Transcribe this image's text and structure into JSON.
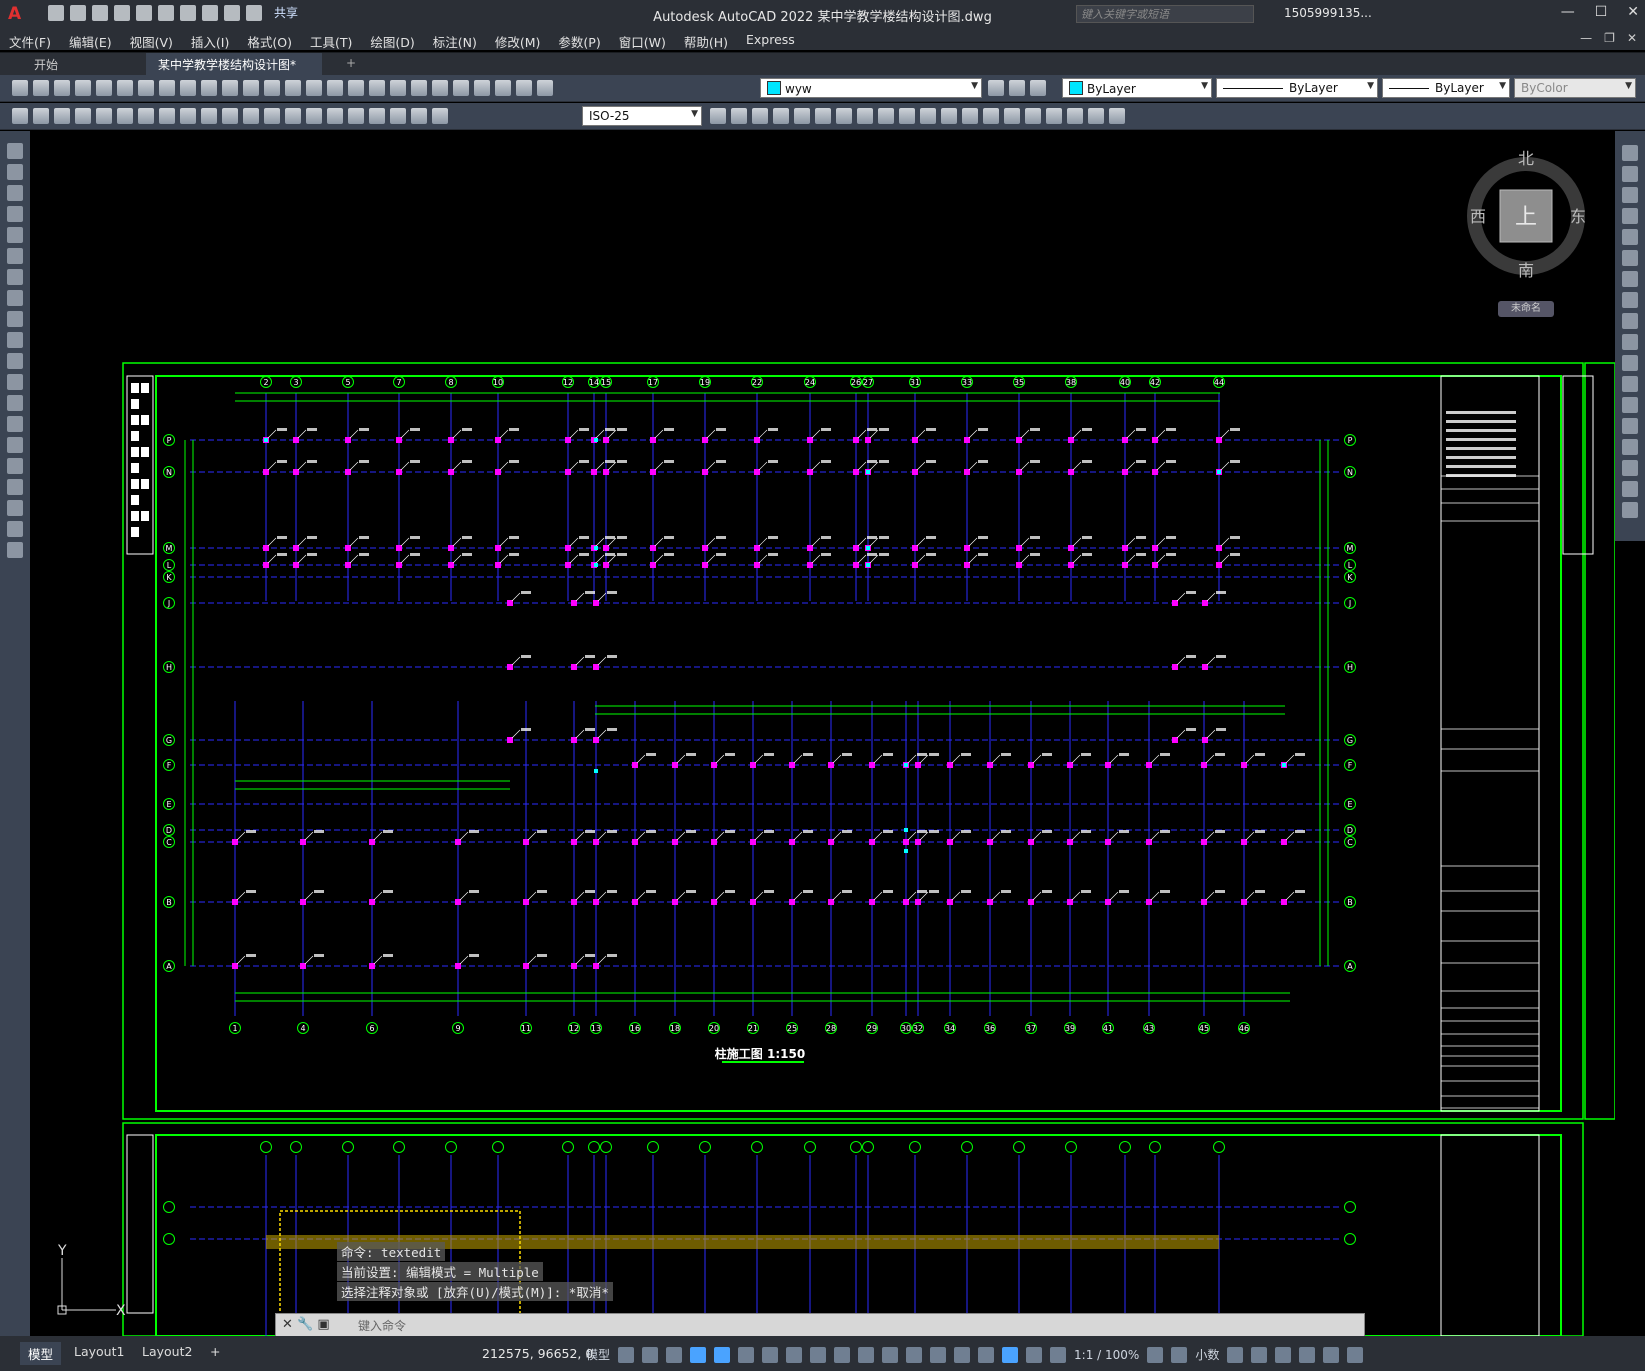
{
  "app": {
    "logo": "A",
    "title": "Autodesk AutoCAD 2022    某中学教学楼结构设计图.dwg",
    "share_label": "共享",
    "search_placeholder": "键入关键字或短语",
    "user": "1505999135...",
    "window_controls": [
      "—",
      "☐",
      "✕"
    ]
  },
  "menu": {
    "items": [
      "文件(F)",
      "编辑(E)",
      "视图(V)",
      "插入(I)",
      "格式(O)",
      "工具(T)",
      "绘图(D)",
      "标注(N)",
      "修改(M)",
      "参数(P)",
      "窗口(W)",
      "帮助(H)",
      "Express"
    ]
  },
  "tabs": {
    "start": "开始",
    "active": "某中学教学楼结构设计图*",
    "close": "✕",
    "add": "+"
  },
  "toolbar": {
    "layer": "wyw",
    "layer_color": "#00e5ff",
    "color": "ByLayer",
    "linetype": "ByLayer",
    "lineweight": "ByLayer",
    "plotstyle": "ByColor",
    "dimstyle": "ISO-25"
  },
  "viewcube": {
    "north": "北",
    "south": "南",
    "west": "西",
    "east": "东",
    "top": "上",
    "wcs": "未命名"
  },
  "drawing": {
    "plan_title": "柱施工图  1:150",
    "ucs_y": "Y",
    "ucs_x": "X",
    "top_grid_labels": [
      "2",
      "3",
      "5",
      "7",
      "8",
      "10",
      "12",
      "14",
      "15",
      "17",
      "19",
      "22",
      "24",
      "26",
      "27",
      "31",
      "33",
      "35",
      "38",
      "40",
      "42",
      "44"
    ],
    "bottom_grid_labels": [
      "1",
      "4",
      "6",
      "9",
      "11",
      "12",
      "13",
      "16",
      "18",
      "20",
      "21",
      "25",
      "28",
      "29",
      "30",
      "32",
      "34",
      "36",
      "37",
      "39",
      "41",
      "43",
      "45",
      "46"
    ],
    "row_labels": [
      "P",
      "N",
      "M",
      "L",
      "K",
      "J",
      "H",
      "G",
      "F",
      "E",
      "D",
      "C",
      "B",
      "A"
    ],
    "colors": {
      "frame": "#00ff00",
      "axis": "#2b2bff",
      "grid_line": "#00ff00",
      "column": "#ff00ff",
      "text": "#ffffff",
      "cyan": "#00ffff"
    }
  },
  "command": {
    "history": [
      "命令:  textedit",
      "当前设置: 编辑模式 = Multiple",
      "选择注释对象或 [放弃(U)/模式(M)]: *取消*"
    ],
    "placeholder": "键入命令"
  },
  "status": {
    "model_tab": "模型",
    "layout1": "Layout1",
    "layout2": "Layout2",
    "add": "+",
    "coords": "212575, 96652, 0",
    "model": "模型",
    "scale": "1:1 / 100%",
    "units": "小数"
  }
}
